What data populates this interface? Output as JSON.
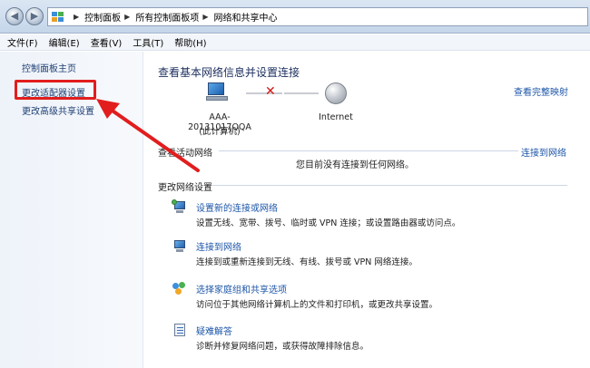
{
  "address": {
    "crumbs": [
      "控制面板",
      "所有控制面板项",
      "网络和共享中心"
    ]
  },
  "menu": [
    "文件(F)",
    "编辑(E)",
    "查看(V)",
    "工具(T)",
    "帮助(H)"
  ],
  "sidebar": {
    "home": "控制面板主页",
    "adapter": "更改适配器设置",
    "sharing": "更改高级共享设置"
  },
  "main": {
    "title": "查看基本网络信息并设置连接",
    "full_map": "查看完整映射",
    "computer_name": "AAA-20131017QQA",
    "computer_sub": "(此计算机)",
    "internet": "Internet",
    "active_heading": "查看活动网络",
    "connect_link": "连接到网络",
    "not_connected": "您目前没有连接到任何网络。",
    "change_heading": "更改网络设置",
    "tasks": [
      {
        "link": "设置新的连接或网络",
        "desc": "设置无线、宽带、拨号、临时或 VPN 连接；或设置路由器或访问点。"
      },
      {
        "link": "连接到网络",
        "desc": "连接到或重新连接到无线、有线、拨号或 VPN 网络连接。"
      },
      {
        "link": "选择家庭组和共享选项",
        "desc": "访问位于其他网络计算机上的文件和打印机，或更改共享设置。"
      },
      {
        "link": "疑难解答",
        "desc": "诊断并修复网络问题，或获得故障排除信息。"
      }
    ]
  },
  "colors": {
    "annotation": "#e21d1d",
    "link": "#1e56a8"
  }
}
